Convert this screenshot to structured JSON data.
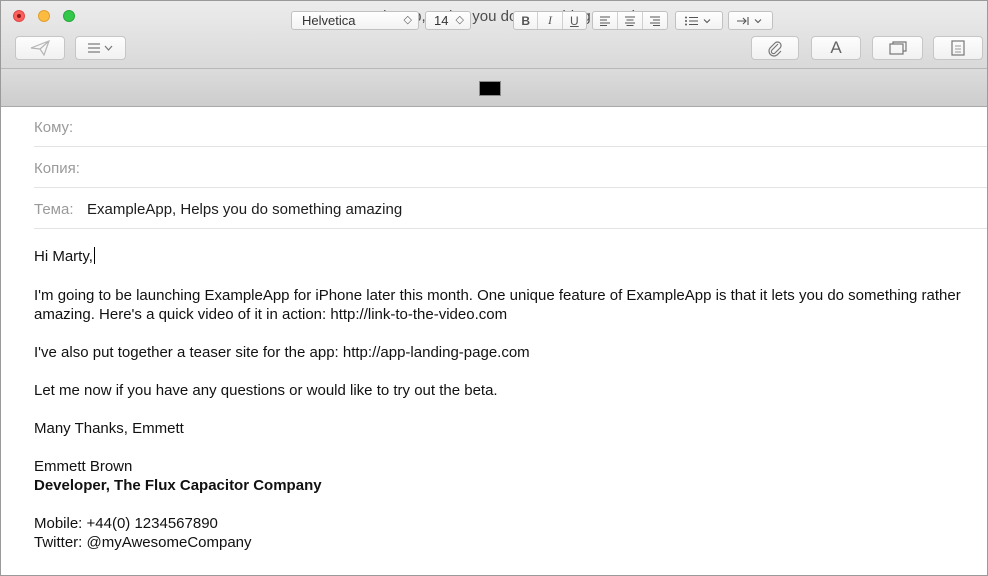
{
  "window": {
    "title": "ExampleApp, Helps you do something amazing"
  },
  "toolbar": {
    "buttons": [
      {
        "name": "send-icon"
      },
      {
        "name": "header-fields-icon"
      },
      {
        "name": "attach-icon"
      },
      {
        "name": "fonts-icon",
        "label": "A"
      },
      {
        "name": "photo-browser-icon"
      },
      {
        "name": "stationery-icon"
      }
    ]
  },
  "format": {
    "font_family": "Helvetica",
    "font_size": "14",
    "text_color": "#000000",
    "bold": "B",
    "italic": "I",
    "underline": "U"
  },
  "fields": {
    "to_label": "Кому:",
    "to_value": "",
    "cc_label": "Копия:",
    "cc_value": "",
    "subject_label": "Тема:",
    "subject_value": "ExampleApp, Helps you do something amazing"
  },
  "message": {
    "greeting": "Hi Marty,",
    "p1": "I'm going to be launching ExampleApp for iPhone later this month. One unique feature of ExampleApp is that it lets you do something rather amazing. Here's a quick video of it in action: http://link-to-the-video.com",
    "p2": "I've also put together a teaser site for the app: http://app-landing-page.com",
    "p3": "Let me now if you have any questions or would like to try out the beta.",
    "thanks": "Many Thanks, Emmett",
    "sig_name": "Emmett Brown",
    "sig_title": "Developer, The Flux Capacitor Company",
    "sig_mobile": "Mobile: +44(0) 1234567890",
    "sig_twitter": "Twitter: @myAwesomeCompany"
  }
}
